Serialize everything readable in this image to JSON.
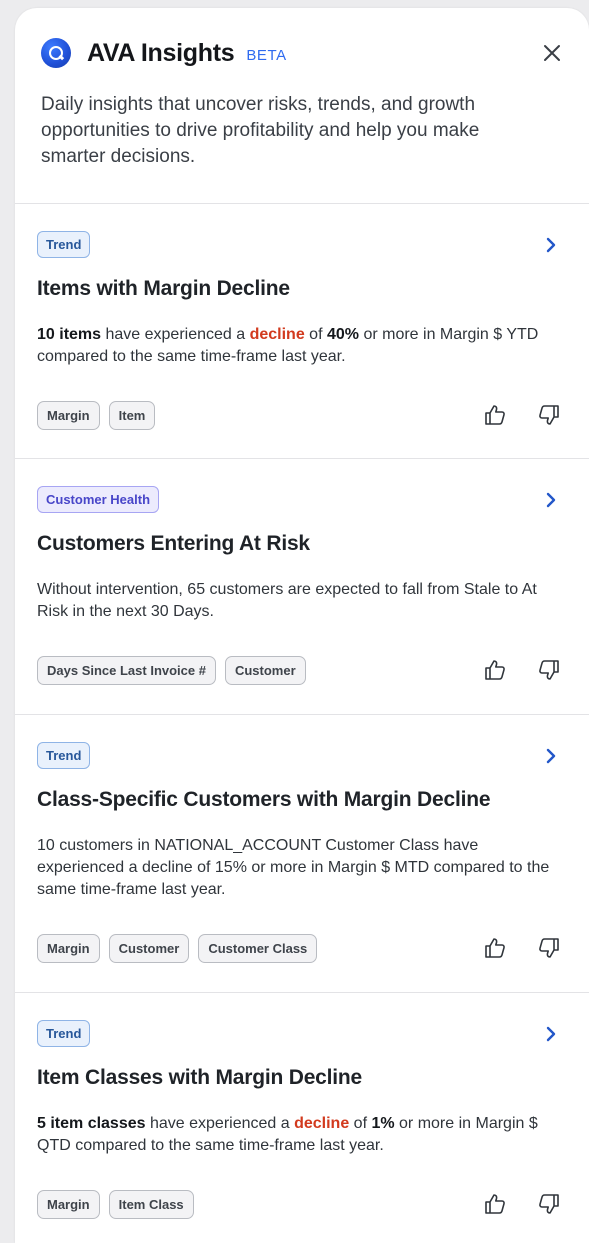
{
  "header": {
    "brand": "AVA Insights",
    "beta": "BETA",
    "intro": "Daily insights that uncover risks, trends, and growth opportunities to drive profitability and help you make smarter decisions."
  },
  "cards": [
    {
      "badge": "Trend",
      "title": "Items with Margin Decline",
      "desc": {
        "count": "10 items",
        "t1": " have experienced a ",
        "decline": "decline",
        "t2": " of ",
        "pct": "40%",
        "t3": " or more in Margin $ YTD compared to the same time-frame last year."
      },
      "tags": [
        "Margin",
        "Item"
      ]
    },
    {
      "badge": "Customer Health",
      "title": "Customers Entering At Risk",
      "desc_text": "Without intervention, 65 customers are expected to fall from Stale to At Risk in the next 30 Days.",
      "tags": [
        "Days Since Last Invoice #",
        "Customer"
      ]
    },
    {
      "badge": "Trend",
      "title": "Class-Specific Customers with Margin Decline",
      "desc_text": "10 customers in NATIONAL_ACCOUNT Customer Class have experienced a decline of 15% or more in Margin $ MTD compared to the same time-frame last year.",
      "tags": [
        "Margin",
        "Customer",
        "Customer Class"
      ]
    },
    {
      "badge": "Trend",
      "title": "Item Classes with Margin Decline",
      "desc": {
        "count": "5 item classes",
        "t1": " have experienced a ",
        "decline": "decline",
        "t2": " of ",
        "pct": "1%",
        "t3": " or more in Margin $ QTD compared to the same time-frame last year."
      },
      "tags": [
        "Margin",
        "Item Class"
      ]
    }
  ],
  "icons": {
    "close": "close-icon",
    "chevron": "chevron-right-icon",
    "thumbs_up": "thumbs-up-icon",
    "thumbs_down": "thumbs-down-icon"
  },
  "colors": {
    "accent": "#2f6bf0",
    "decline": "#d23a1e",
    "trend_badge": "#e9f1fc",
    "health_badge": "#ecebfd"
  }
}
